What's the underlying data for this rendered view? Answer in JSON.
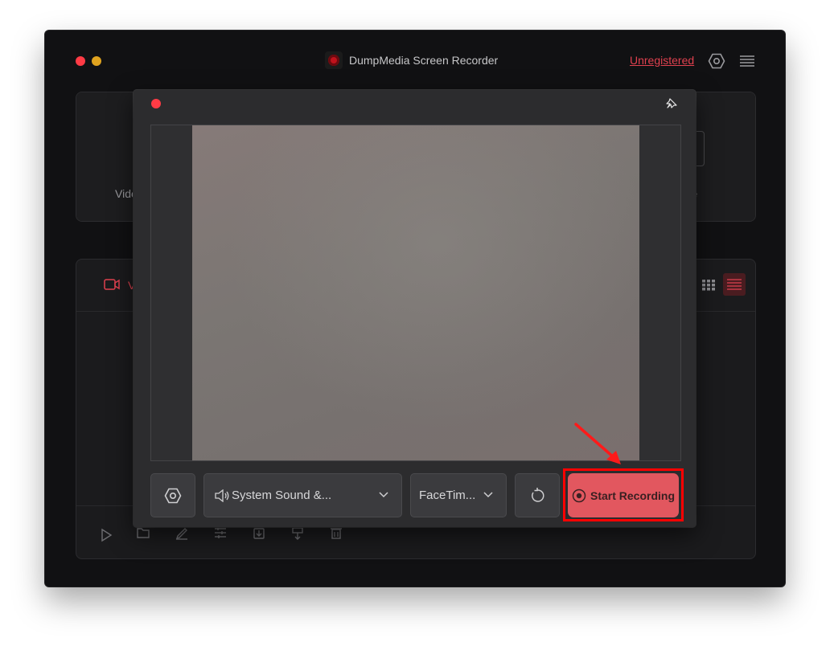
{
  "app": {
    "title": "DumpMedia Screen Recorder",
    "unregistered_label": "Unregistered",
    "brand_color": "#e0414f"
  },
  "mode_cards": [
    {
      "label": "Vide"
    },
    {
      "label": ""
    },
    {
      "label": ""
    },
    {
      "label": "ture"
    }
  ],
  "list": {
    "tab_label": "V"
  },
  "camera_window": {
    "sound_select_label": "System Sound &...",
    "camera_select_label": "FaceTim...",
    "start_recording_label": "Start Recording"
  },
  "icons": {
    "close": "red-dot",
    "minimize": "yellow-dot",
    "settings": "hexagon-gear-icon",
    "menu": "hamburger-icon",
    "pin": "pin-icon",
    "speaker": "speaker-icon",
    "chevron": "chevron-down-icon",
    "refresh": "rotate-icon",
    "record": "record-circle-icon"
  }
}
